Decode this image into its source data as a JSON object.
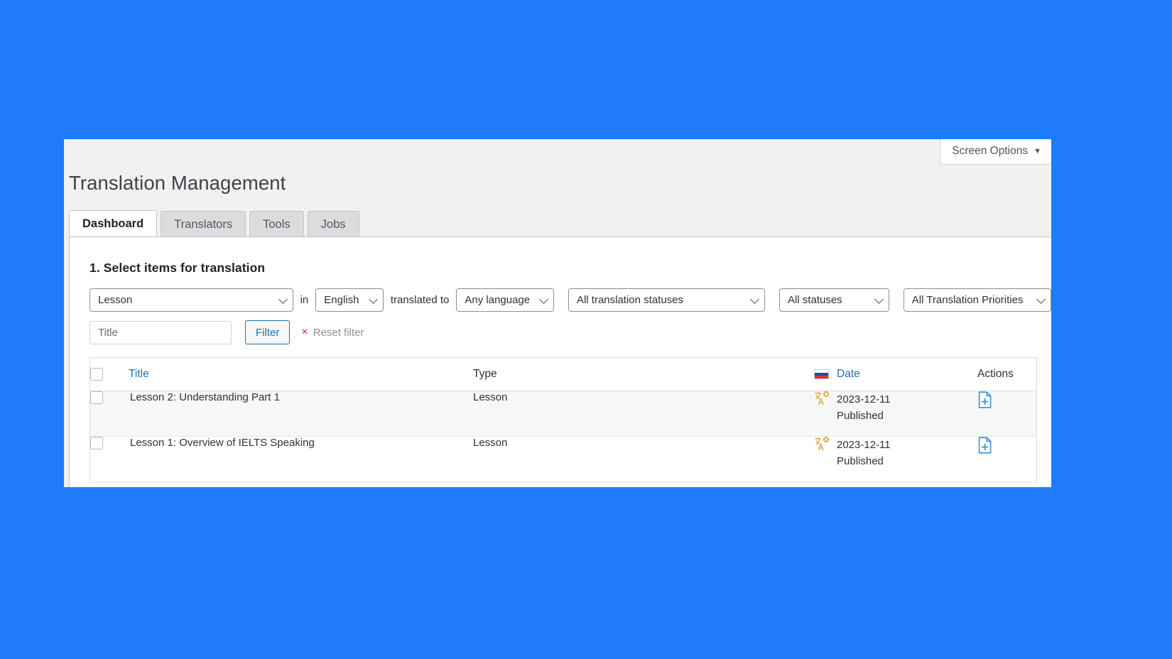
{
  "theme": {
    "page_background": "#1f7afc",
    "panel_background": "#f1f1f1",
    "accent_link": "#2271b1",
    "danger": "#d63638",
    "status_icon": "#e8a33d"
  },
  "header": {
    "page_title": "Translation Management",
    "screen_options_label": "Screen Options",
    "screen_options_caret": "▼"
  },
  "tabs": [
    {
      "label": "Dashboard",
      "active": true
    },
    {
      "label": "Translators",
      "active": false
    },
    {
      "label": "Tools",
      "active": false
    },
    {
      "label": "Jobs",
      "active": false
    }
  ],
  "main": {
    "section_title": "1. Select items for translation",
    "filters": {
      "post_type": {
        "value": "Lesson",
        "icon": "chevron-down-icon"
      },
      "label_in": "in",
      "source_language": {
        "value": "English",
        "icon": "chevron-down-icon"
      },
      "label_translated_to": "translated to",
      "target_language": {
        "value": "Any language",
        "icon": "chevron-down-icon"
      },
      "translation_status": {
        "value": "All translation statuses",
        "icon": "chevron-down-icon"
      },
      "status": {
        "value": "All statuses",
        "icon": "chevron-down-icon"
      },
      "priority": {
        "value": "All Translation Priorities",
        "icon": "chevron-down-icon"
      },
      "title_search": {
        "value": "",
        "placeholder": "Title"
      },
      "filter_button": "Filter",
      "reset_filter": "Reset filter",
      "reset_filter_icon": "×"
    },
    "table": {
      "columns": {
        "select_all": "",
        "title": "Title",
        "type": "Type",
        "date": "Date",
        "date_flag": "flag-russia-icon",
        "actions": "Actions"
      },
      "rows": [
        {
          "selected": false,
          "title": "Lesson 2: Understanding Part 1",
          "type": "Lesson",
          "translation_status_icon": "translate-pending-icon",
          "date": "2023-12-11",
          "status": "Published",
          "action_icon": "add-translation-document-icon"
        },
        {
          "selected": false,
          "title": "Lesson 1: Overview of IELTS Speaking",
          "type": "Lesson",
          "translation_status_icon": "translate-pending-icon",
          "date": "2023-12-11",
          "status": "Published",
          "action_icon": "add-translation-document-icon"
        }
      ]
    }
  }
}
